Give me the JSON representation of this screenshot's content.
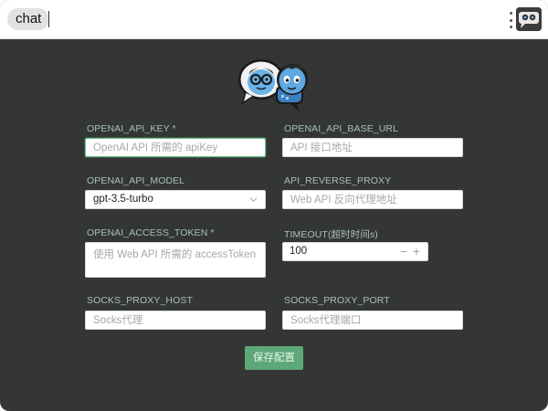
{
  "topbar": {
    "chat_label": "chat"
  },
  "colors": {
    "background": "#333634",
    "label": "#a9bfc0",
    "button": "#5da877",
    "focus": "#66c08a"
  },
  "icons": {
    "menu": "vertical-dots-icon",
    "avatar": "app-avatar-icon",
    "logo": "chatgpt-web-logo",
    "select": "chevron-down-icon"
  },
  "form": {
    "api_key": {
      "label": "OPENAI_API_KEY *",
      "value": "",
      "placeholder": "OpenAI API 所需的 apiKey"
    },
    "api_base_url": {
      "label": "OPENAI_API_BASE_URL",
      "value": "",
      "placeholder": "API 接口地址"
    },
    "api_model": {
      "label": "OPENAI_API_MODEL",
      "value": "gpt-3.5-turbo"
    },
    "reverse_proxy": {
      "label": "API_REVERSE_PROXY",
      "value": "",
      "placeholder": "Web API 反向代理地址"
    },
    "access_token": {
      "label": "OPENAI_ACCESS_TOKEN *",
      "value": "",
      "placeholder": "使用 Web API 所需的 accessToken"
    },
    "timeout": {
      "label": "TIMEOUT(超时时间s)",
      "value": "100",
      "minus": "−",
      "plus": "+"
    },
    "socks_host": {
      "label": "SOCKS_PROXY_HOST",
      "value": "",
      "placeholder": "Socks代理"
    },
    "socks_port": {
      "label": "SOCKS_PROXY_PORT",
      "value": "",
      "placeholder": "Socks代理端口"
    },
    "save_label": "保存配置"
  }
}
